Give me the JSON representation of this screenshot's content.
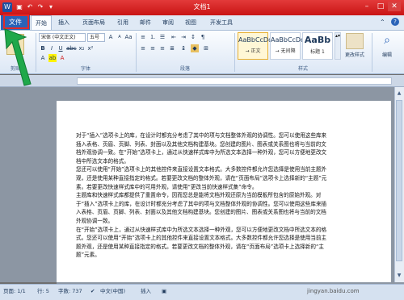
{
  "window": {
    "title": "文档1"
  },
  "tabs": {
    "file": "文件",
    "items": [
      "开始",
      "插入",
      "页面布局",
      "引用",
      "邮件",
      "审阅",
      "视图",
      "开发工具"
    ]
  },
  "ribbon": {
    "font_name": "宋体 (中文正文)",
    "font_size": "五号",
    "group_font": "字体",
    "group_para": "段落",
    "group_styles": "样式",
    "styles": [
      {
        "sample": "AaBbCcDd",
        "name": "→ 正文"
      },
      {
        "sample": "AaBbCcDd",
        "name": "→ 无间隔"
      },
      {
        "sample": "AaBb",
        "name": "标题 1"
      }
    ],
    "change_styles": "更改样式",
    "edit": "编辑"
  },
  "document": {
    "paragraphs": [
      "对于“插入”选项卡上的库，在设计时都充分考虑了其中的项与文档整体外观的协调性。您可以使用这些库来插入表格、页眉、页脚、列表、封面以及其他文档构建基块。您创建的图片、图表或关系图也将与当前的文档外观协调一致。在“开始”选项卡上，通过从快速样式库中为所选文本选择一种外观，您可以方便地更改文档中所选文本的格式。",
      "您还可以使用“开始”选项卡上的其他控件来直接设置文本格式。大多数控件都允许您选择是使用当前主题外观，还是使用某种直接指定的格式。若要更改文档的整体外观，请在“页面布局”选项卡上选择新的“主题”元素。若要更改快速样式库中的可用外观，请使用“更改当前快速样式集”命令。",
      "主题库和快速样式库都提供了重置命令，因而您总是能将文档外观还原为当前模板所包含的原始外观。对于“插入”选项卡上的库，在设计时都充分考虑了其中的项与文档整体外观的协调性。您可以使用这些库来插入表格、页眉、页脚、列表、封面以及其他文档构建基块。您创建的图片、图表或关系图也将与当前的文档外观协调一致。",
      "在“开始”选项卡上，通过从快速样式库中为所选文本选择一种外观，您可以方便地更改文档中所选文本的格式。您还可以使用“开始”选项卡上的其他控件来直接设置文本格式。大多数控件都允许您选择是使用当前主题外观，还是使用某种直接指定的格式。若要更改文档的整体外观，请在“页面布局”选项卡上选择新的“主题”元素。"
    ]
  },
  "status": {
    "page": "页面: 1/1",
    "line": "行: 5",
    "words": "字数: 737",
    "lang": "中文(中国)",
    "insert": "插入"
  },
  "watermark": "jingyan.baidu.com",
  "colors": {
    "title_bar": "#c91414",
    "file_tab": "#2a63b8",
    "highlight": "#e02a2a",
    "arrow": "#1fa84a"
  }
}
